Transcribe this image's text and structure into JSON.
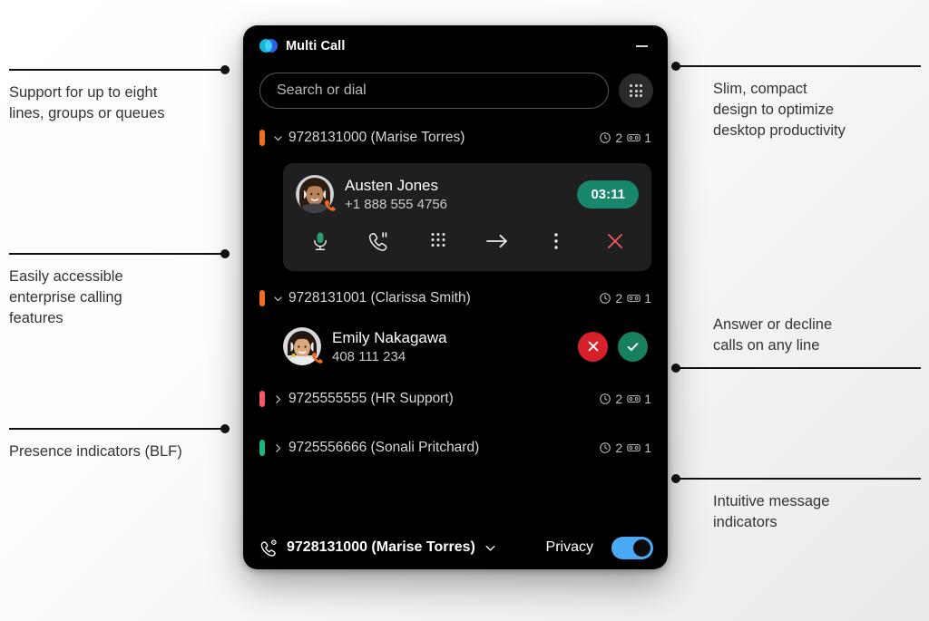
{
  "window": {
    "app_title": "Multi Call",
    "logo_icon": "webex-logo-icon",
    "minimize_icon": "minimize-icon"
  },
  "search": {
    "placeholder": "Search or dial",
    "value": "",
    "keypad_icon": "keypad-icon"
  },
  "lines": [
    {
      "blf_color": "#f26d1d",
      "blf_state": "busy",
      "chevron": "chevron-down",
      "label": "9728131000 (Marise Torres)",
      "missed_calls": "2",
      "voicemails": "1"
    },
    {
      "blf_color": "#f26d1d",
      "blf_state": "busy",
      "chevron": "chevron-down",
      "label": "9728131001 (Clarissa Smith)",
      "missed_calls": "2",
      "voicemails": "1"
    },
    {
      "blf_color": "#f9556b",
      "blf_state": "dnd",
      "chevron": "chevron-right",
      "label": "9725555555 (HR Support)",
      "missed_calls": "2",
      "voicemails": "1"
    },
    {
      "blf_color": "#1ab87a",
      "blf_state": "available",
      "chevron": "chevron-right",
      "label": "9725556666 (Sonali Pritchard)",
      "missed_calls": "2",
      "voicemails": "1"
    }
  ],
  "active_call": {
    "caller_name": "Austen Jones",
    "caller_number": "+1 888 555 4756",
    "duration": "03:11",
    "duration_color": "#17866a",
    "avatar_icon": "avatar-austen-jones",
    "phone_badge_icon": "phone-badge-icon",
    "actions": [
      {
        "name": "mute-button",
        "icon": "microphone-icon"
      },
      {
        "name": "hold-button",
        "icon": "phone-hold-icon"
      },
      {
        "name": "keypad-button",
        "icon": "keypad-icon"
      },
      {
        "name": "transfer-button",
        "icon": "arrow-right-icon"
      },
      {
        "name": "more-options-button",
        "icon": "more-vertical-icon"
      },
      {
        "name": "end-call-button",
        "icon": "close-x-icon"
      }
    ]
  },
  "incoming_call": {
    "caller_name": "Emily Nakagawa",
    "caller_number": "408 111 234",
    "avatar_icon": "avatar-emily-nakagawa",
    "phone_badge_icon": "phone-badge-icon",
    "decline_icon": "decline-x-icon",
    "accept_icon": "accept-check-icon",
    "decline_color": "#d8202a",
    "accept_color": "#16805f"
  },
  "bottom_bar": {
    "line_icon": "phone-settings-icon",
    "active_line": "9728131000 (Marise Torres)",
    "chevron_icon": "chevron-down-icon",
    "privacy_label": "Privacy",
    "privacy_enabled": true,
    "toggle_color": "#49a9f5"
  },
  "callouts": [
    {
      "id": "lines",
      "text": "Support for up to eight\nlines, groups or queues"
    },
    {
      "id": "features",
      "text": "Easily accessible\nenterprise calling\nfeatures"
    },
    {
      "id": "presence",
      "text": "Presence indicators (BLF)"
    },
    {
      "id": "design",
      "text": "Slim, compact\ndesign to optimize\ndesktop productivity"
    },
    {
      "id": "answer",
      "text": "Answer or decline\ncalls on any line"
    },
    {
      "id": "messages",
      "text": "Intuitive message\nindicators"
    }
  ]
}
